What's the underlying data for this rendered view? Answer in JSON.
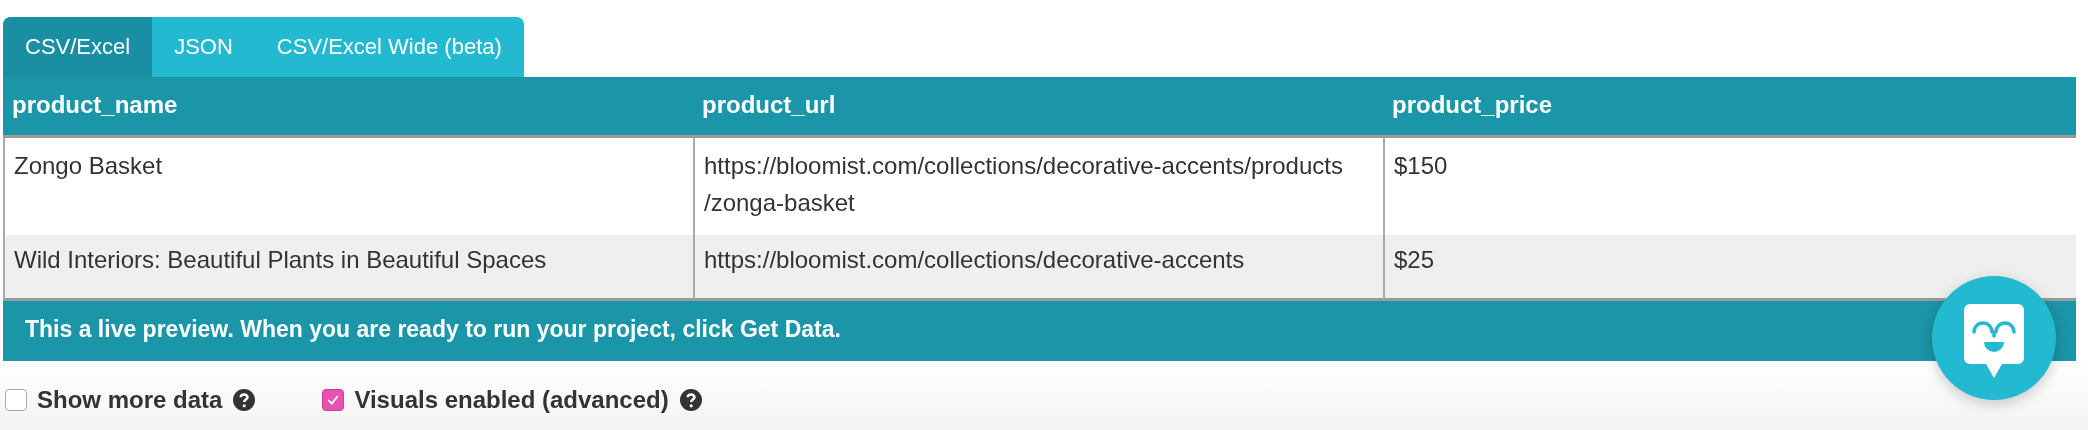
{
  "tabs": [
    {
      "label": "CSV/Excel",
      "selected": true
    },
    {
      "label": "JSON",
      "selected": false
    },
    {
      "label": "CSV/Excel Wide (beta)",
      "selected": false
    }
  ],
  "table": {
    "columns": [
      "product_name",
      "product_url",
      "product_price"
    ],
    "rows": [
      [
        "Zongo Basket",
        "https://bloomist.com/collections/decorative-accents/products/zonga-basket",
        "$150"
      ],
      [
        "Wild Interiors: Beautiful Plants in Beautiful Spaces",
        "https://bloomist.com/collections/decorative-accents",
        "$25"
      ]
    ]
  },
  "banner": "This a live preview. When you are ready to run your project, click Get Data.",
  "options": [
    {
      "label": "Show more data",
      "checked": false
    },
    {
      "label": "Visuals enabled (advanced)",
      "checked": true
    }
  ]
}
